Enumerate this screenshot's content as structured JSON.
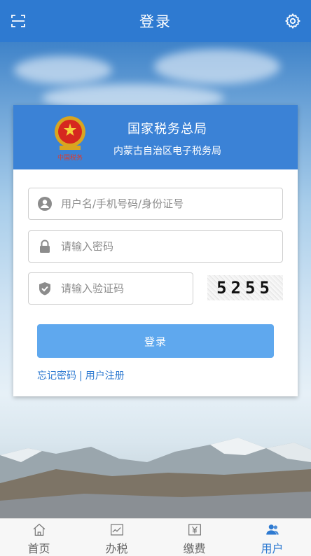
{
  "header": {
    "title": "登录",
    "left_icon": "scan-icon",
    "right_icon": "gear-icon"
  },
  "card": {
    "org_name": "国家税务总局",
    "org_sub": "内蒙古自治区电子税务局",
    "emblem_icon": "tax-emblem-icon",
    "username": {
      "placeholder": "用户名/手机号码/身份证号",
      "value": "",
      "icon": "user-icon"
    },
    "password": {
      "placeholder": "请输入密码",
      "value": "",
      "icon": "lock-icon"
    },
    "captcha_input": {
      "placeholder": "请输入验证码",
      "value": "",
      "icon": "shield-icon"
    },
    "captcha_image_text": "5255",
    "login_button": "登录",
    "forgot_password": "忘记密码",
    "separator": "|",
    "register": "用户注册"
  },
  "tabs": [
    {
      "label": "首页",
      "icon": "home-icon",
      "active": false
    },
    {
      "label": "办税",
      "icon": "chart-icon",
      "active": false
    },
    {
      "label": "缴费",
      "icon": "yuan-icon",
      "active": false
    },
    {
      "label": "用户",
      "icon": "users-icon",
      "active": true
    }
  ],
  "colors": {
    "primary": "#2e7ad1",
    "card_header": "#3b82d6",
    "button": "#5fa8ee"
  }
}
